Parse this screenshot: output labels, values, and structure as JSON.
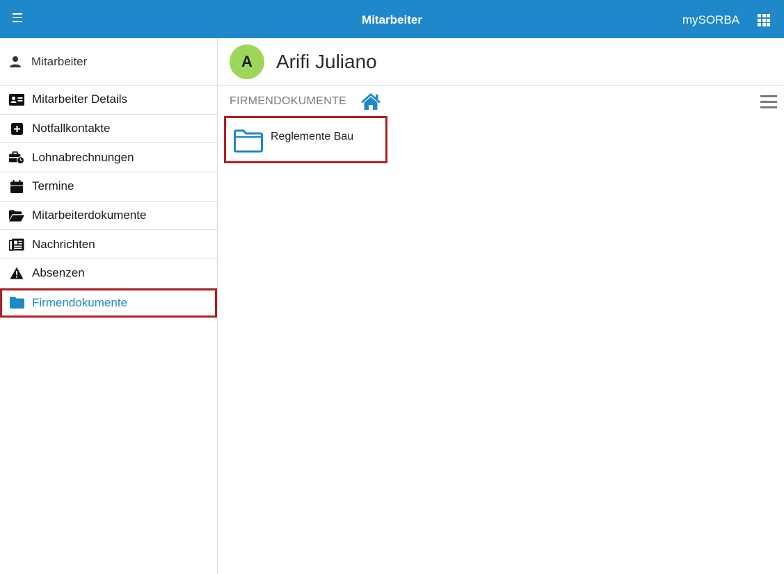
{
  "topbar": {
    "title": "Mitarbeiter",
    "brand": "mySORBA",
    "menu_icon": "hamburger-icon",
    "apps_icon": "grid-icon",
    "color": "#1f88ca"
  },
  "sidebar": {
    "header": {
      "label": "Mitarbeiter",
      "icon": "user-icon"
    },
    "items": [
      {
        "label": "Mitarbeiter Details",
        "icon": "id-card-icon"
      },
      {
        "label": "Notfallkontakte",
        "icon": "plus-square-icon"
      },
      {
        "label": "Lohnabrechnungen",
        "icon": "briefcase-clock-icon"
      },
      {
        "label": "Termine",
        "icon": "calendar-icon"
      },
      {
        "label": "Mitarbeiterdokumente",
        "icon": "folder-open-icon"
      },
      {
        "label": "Nachrichten",
        "icon": "newspaper-icon"
      },
      {
        "label": "Absenzen",
        "icon": "warning-icon"
      },
      {
        "label": "Firmendokumente",
        "icon": "folder-icon",
        "active": true
      }
    ],
    "active_color": "#1f88ca",
    "highlight_color": "#b01f24"
  },
  "main": {
    "avatar_letter": "A",
    "avatar_color": "#9cd75a",
    "person_name": "Arifi Juliano",
    "breadcrumb": "FIRMENDOKUMENTE",
    "home_icon": "home-icon",
    "list_menu_icon": "list-menu-icon",
    "folders": [
      {
        "label": "Reglemente Bau",
        "icon": "folder-outline-icon"
      }
    ]
  }
}
